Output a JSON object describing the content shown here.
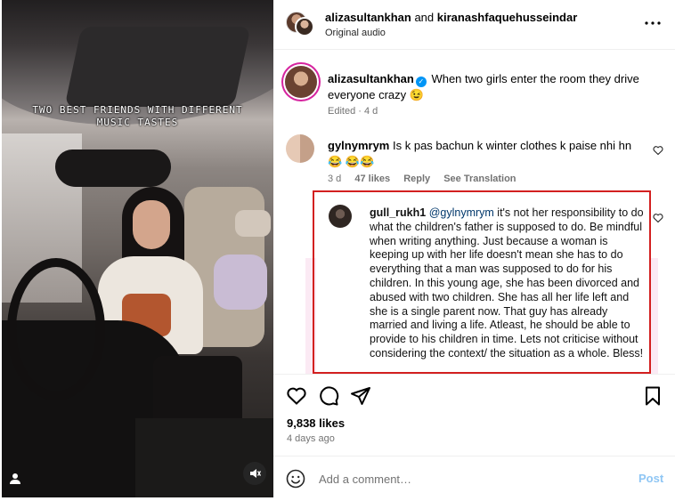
{
  "video": {
    "overlay_text": "TWO BEST FRIENDS WITH DIFFERENT MUSIC TASTES",
    "user_tag_icon": "user-icon",
    "mute_icon": "speaker-muted-icon"
  },
  "header": {
    "user1": "alizasultankhan",
    "and": "and",
    "user2": "kiranashfaquehusseindar",
    "audio": "Original audio",
    "more_icon": "more-horizontal-icon"
  },
  "caption": {
    "username": "alizasultankhan",
    "text": "When two girls enter the room they drive everyone crazy 😉",
    "meta": "Edited · 4 d"
  },
  "comments": [
    {
      "username": "gylnymrym",
      "text": "Is k pas bachun k winter clothes k paise nhi hn😂 😂😂",
      "time": "3 d",
      "likes": "47 likes",
      "reply": "Reply",
      "see_translation": "See Translation"
    },
    {
      "username": "gull_rukh1",
      "mention": "@gylnymrym",
      "text": "it's not her responsibility to do what the children's father is supposed to do. Be mindful when writing anything. Just because a woman is keeping up with her life doesn't mean she has to do everything that a man was supposed to do for his children. In this young age, she has been divorced and abused with two children. She has all her life left and she is a single parent now. That guy has already married and living a life. Atleast, he should be able to provide to his children in time. Lets not criticise without considering the context/ the situation as a whole. Bless!"
    }
  ],
  "stats": {
    "likes": "9,838 likes",
    "ago": "4 days ago"
  },
  "add_comment": {
    "placeholder": "Add a comment…",
    "post_label": "Post"
  },
  "colors": {
    "highlight_border": "#d32020",
    "link": "#00376b",
    "verified": "#0095f6",
    "post_disabled": "#8fc6f4"
  }
}
